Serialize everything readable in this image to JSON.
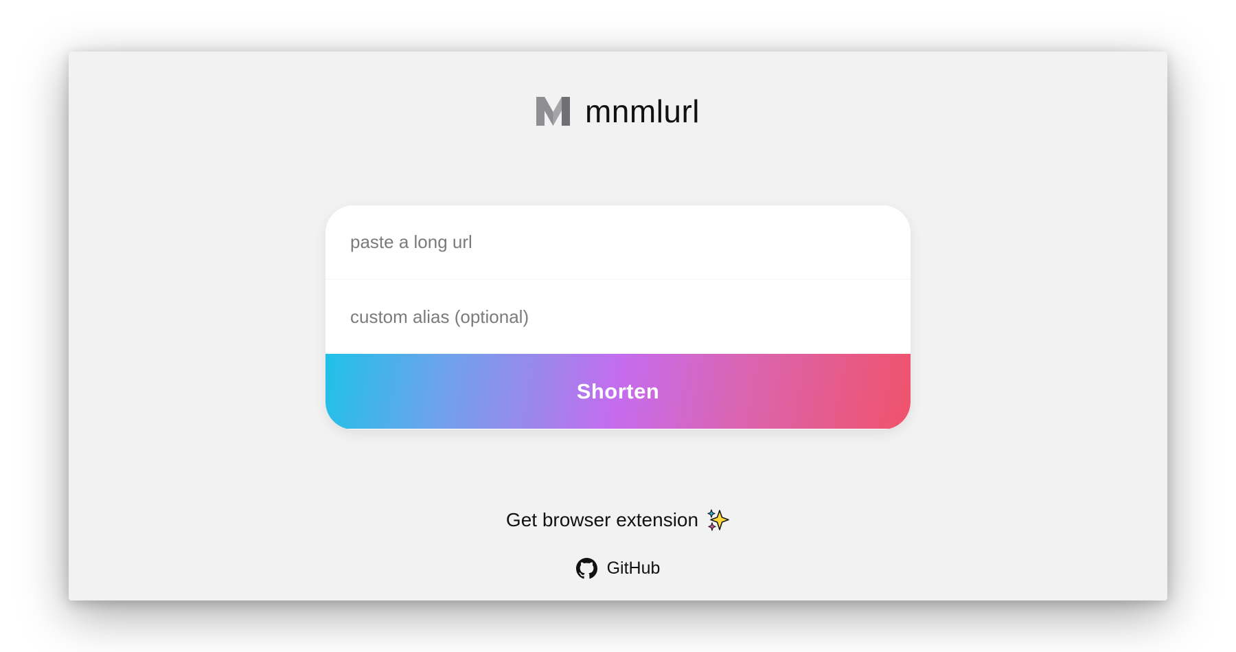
{
  "app": {
    "name": "mnmlurl",
    "logo_icon": "m-logo-icon"
  },
  "form": {
    "url_placeholder": "paste a long url",
    "url_value": "",
    "alias_placeholder": "custom alias (optional)",
    "alias_value": "",
    "submit_label": "Shorten"
  },
  "footer": {
    "extension_label": "Get browser extension",
    "extension_icon": "sparkles-icon",
    "github_label": "GitHub",
    "github_icon": "github-icon"
  },
  "colors": {
    "background": "#f2f2f2",
    "card": "#ffffff",
    "gradient_start": "#1fc1e8",
    "gradient_mid": "#c56cee",
    "gradient_end": "#f0536b",
    "text": "#111111",
    "placeholder": "#7b7b7b"
  }
}
